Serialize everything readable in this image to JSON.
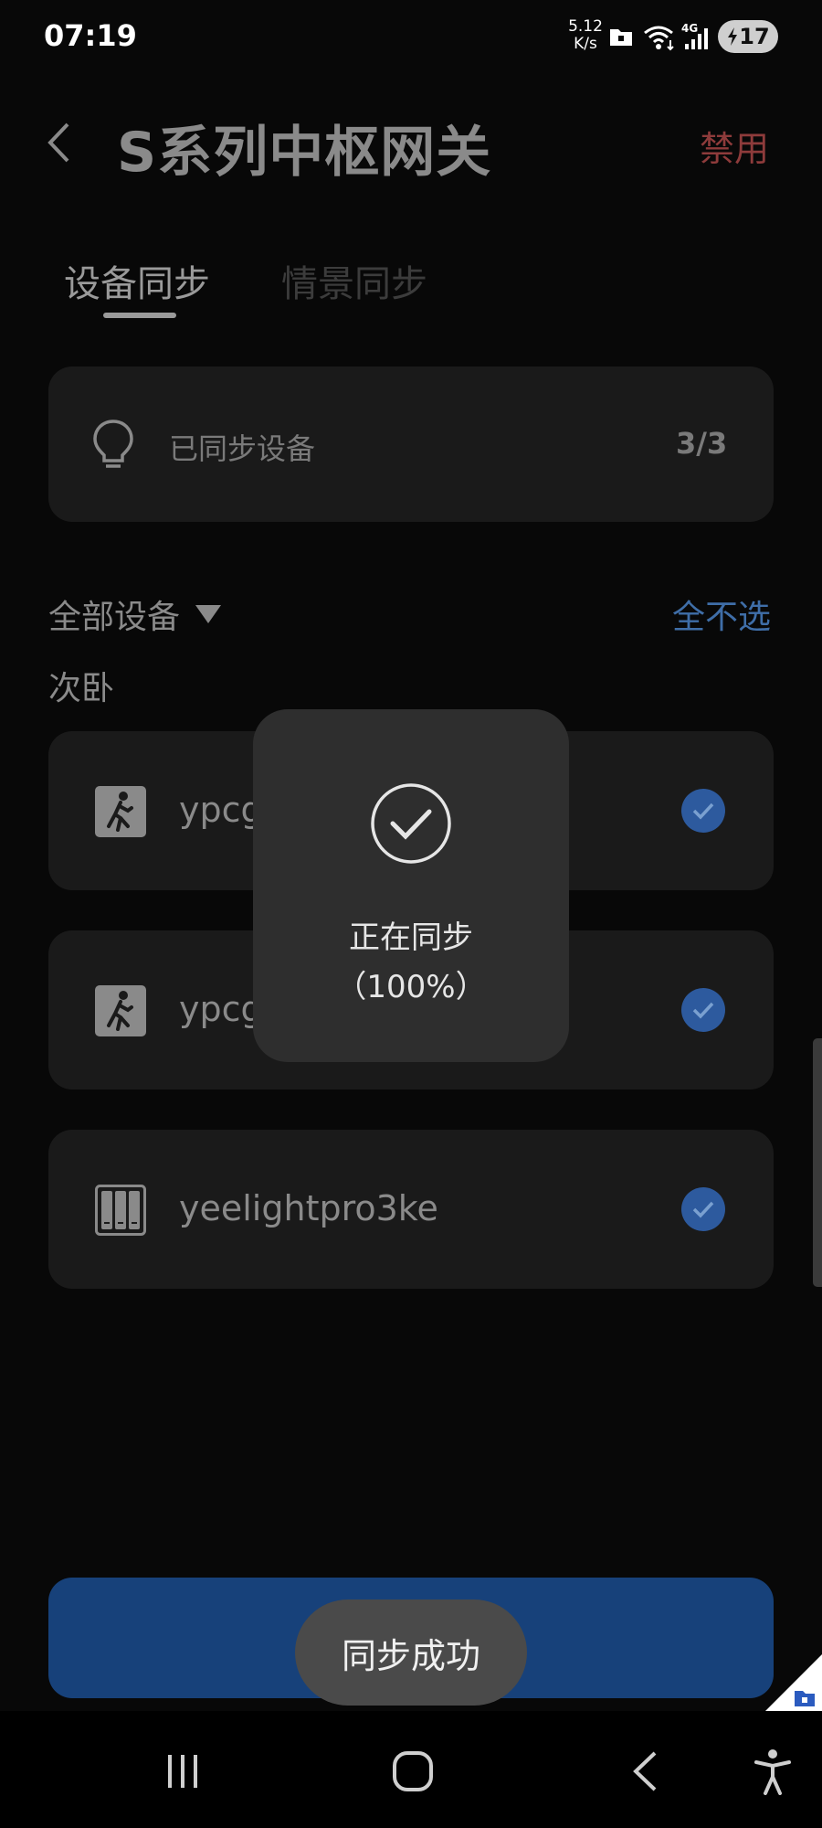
{
  "status_bar": {
    "time": "07:19",
    "net_speed_value": "5.12",
    "net_speed_unit": "K/s",
    "network_type": "4G",
    "battery_level": "17",
    "icons": [
      "folder-lock-icon",
      "wifi-icon",
      "signal-icon",
      "battery-charging-icon"
    ]
  },
  "header": {
    "title": "S系列中枢网关",
    "action_label": "禁用",
    "action_color": "#8e3b3b"
  },
  "tabs": [
    {
      "label": "设备同步",
      "active": true
    },
    {
      "label": "情景同步",
      "active": false
    }
  ],
  "summary": {
    "label": "已同步设备",
    "count": "3/3",
    "icon": "lightbulb-icon"
  },
  "filter": {
    "label": "全部设备",
    "deselect_all_label": "全不选",
    "accent_color": "#3f6ea8"
  },
  "room": "次卧",
  "devices": [
    {
      "name": "ypcg",
      "icon": "motion-sensor-icon",
      "checked": true
    },
    {
      "name": "ypcg",
      "icon": "motion-sensor-icon",
      "checked": true
    },
    {
      "name": "yeelightpro3ke",
      "icon": "switch-panel-icon",
      "checked": true
    }
  ],
  "modal": {
    "line1": "正在同步",
    "line2": "（100%）",
    "icon": "check-circle-icon"
  },
  "toast": "同步成功",
  "primary_button_color": "#17417a"
}
